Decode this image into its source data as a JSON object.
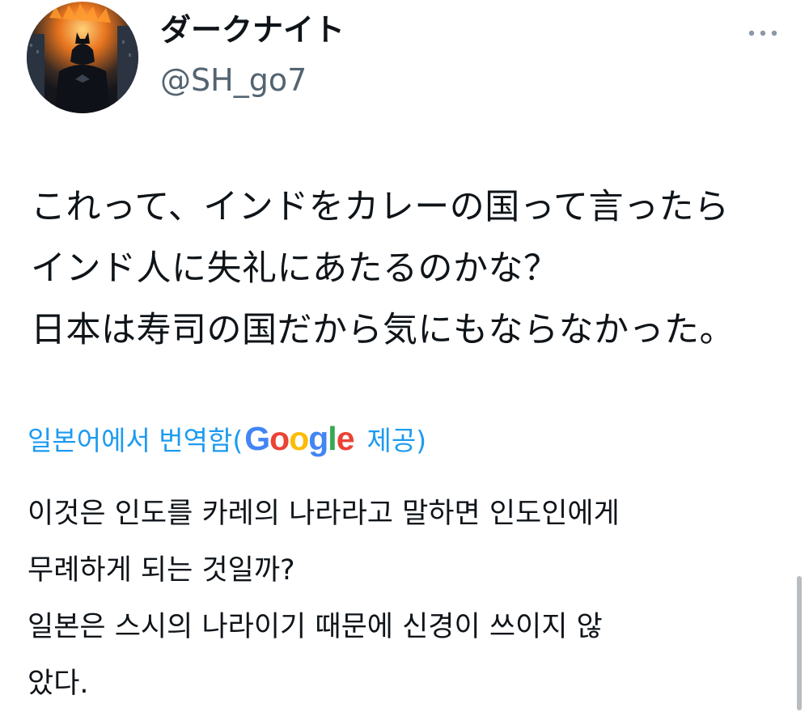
{
  "author": {
    "display_name": "ダークナイト",
    "handle": "@SH_go7",
    "avatar_icon": "batman-avatar"
  },
  "more_icon": "more-dots-icon",
  "tweet": {
    "lines": [
      "これって、インドをカレーの国って言ったら",
      "インド人に失礼にあたるのかな？",
      "日本は寿司の国だから気にもならなかった。"
    ]
  },
  "translation": {
    "label": "일본어에서 번역함(",
    "provider": "Google",
    "suffix": "제공)",
    "link_color": "#1d9bf0",
    "lines": [
      "이것은 인도를 카레의 나라라고 말하면 인도인에게",
      "무례하게 되는 것일까?",
      "일본은 스시의 나라이기 때문에 신경이 쓰이지 않",
      "았다."
    ]
  },
  "colors": {
    "text": "#0f1419",
    "secondary": "#536471",
    "link": "#1d9bf0"
  }
}
